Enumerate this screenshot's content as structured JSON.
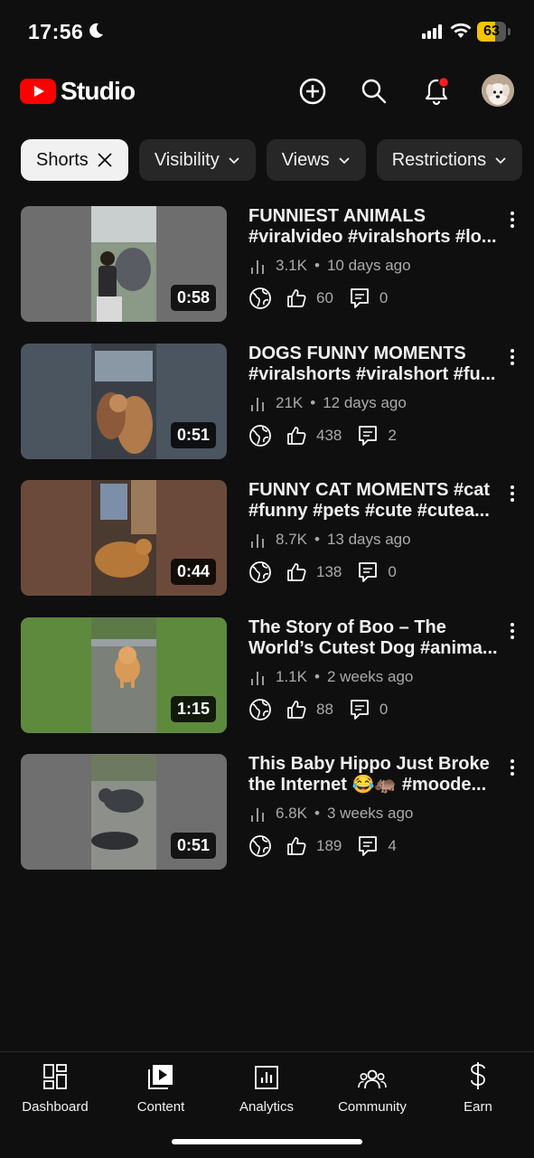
{
  "status": {
    "time": "17:56",
    "battery": "63",
    "battery_fraction": 0.63
  },
  "header": {
    "app_name": "Studio",
    "brand_color": "#ff0000"
  },
  "filters": [
    {
      "label": "Shorts",
      "active": true,
      "icon": "close-icon"
    },
    {
      "label": "Visibility",
      "active": false,
      "icon": "chevron-down-icon"
    },
    {
      "label": "Views",
      "active": false,
      "icon": "chevron-down-icon"
    },
    {
      "label": "Restrictions",
      "active": false,
      "icon": "chevron-down-icon"
    }
  ],
  "videos": [
    {
      "title_line1": "FUNNIEST ANIMALS",
      "title_line2": "#viralvideo #viralshorts #lo...",
      "views": "3.1K",
      "age": "10 days ago",
      "likes": "60",
      "comments": "0",
      "duration": "0:58",
      "side_color": "#6e6e6e"
    },
    {
      "title_line1": "DOGS FUNNY MOMENTS",
      "title_line2": "#viralshorts #viralshort #fu...",
      "views": "21K",
      "age": "12 days ago",
      "likes": "438",
      "comments": "2",
      "duration": "0:51",
      "side_color": "#4b5560"
    },
    {
      "title_line1": "FUNNY CAT MOMENTS #cat",
      "title_line2": "#funny #pets #cute #cutea...",
      "views": "8.7K",
      "age": "13 days ago",
      "likes": "138",
      "comments": "0",
      "duration": "0:44",
      "side_color": "#6b4a3b"
    },
    {
      "title_line1": "The Story of Boo – The",
      "title_line2": "World’s Cutest Dog #anima...",
      "views": "1.1K",
      "age": "2 weeks ago",
      "likes": "88",
      "comments": "0",
      "duration": "1:15",
      "side_color": "#5e8a3e"
    },
    {
      "title_line1": "This Baby Hippo Just Broke",
      "title_line2": "the Internet 😂🦛 #moode...",
      "views": "6.8K",
      "age": "3 weeks ago",
      "likes": "189",
      "comments": "4",
      "duration": "0:51",
      "side_color": "#6f6f6f"
    }
  ],
  "nav": [
    {
      "label": "Dashboard",
      "icon": "dashboard-icon"
    },
    {
      "label": "Content",
      "icon": "content-icon"
    },
    {
      "label": "Analytics",
      "icon": "analytics-icon"
    },
    {
      "label": "Community",
      "icon": "community-icon"
    },
    {
      "label": "Earn",
      "icon": "earn-icon"
    }
  ]
}
